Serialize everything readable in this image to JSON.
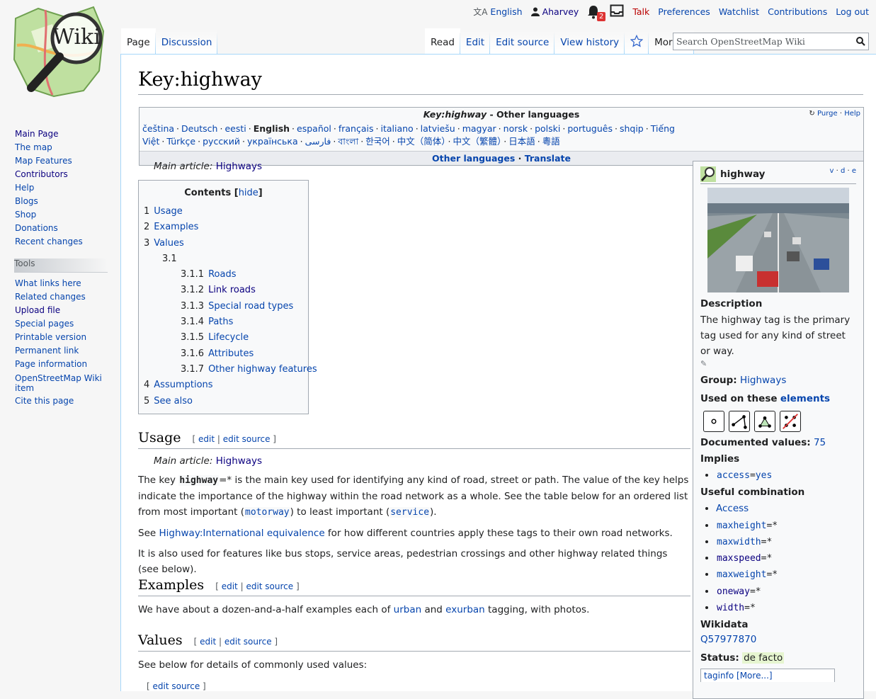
{
  "personal": {
    "language": "English",
    "user": "Aharvey",
    "notifications_count": "2",
    "talk": "Talk",
    "preferences": "Preferences",
    "watchlist": "Watchlist",
    "contributions": "Contributions",
    "logout": "Log out"
  },
  "tabs_left": [
    "Page",
    "Discussion"
  ],
  "tabs_right": [
    "Read",
    "Edit",
    "Edit source",
    "View history"
  ],
  "more_label": "More",
  "search": {
    "placeholder": "Search OpenStreetMap Wiki"
  },
  "sidebar": {
    "nav": [
      "Main Page",
      "The map",
      "Map Features",
      "Contributors",
      "Help",
      "Blogs",
      "Shop",
      "Donations",
      "Recent changes"
    ],
    "tools_heading": "Tools",
    "tools": [
      "What links here",
      "Related changes",
      "Upload file",
      "Special pages",
      "Printable version",
      "Permanent link",
      "Page information",
      "OpenStreetMap Wiki item",
      "Cite this page"
    ]
  },
  "page_title": "Key:highway",
  "langbox": {
    "title_italic": "Key:highway",
    "title_rest": " - Other languages",
    "purge": "Purge",
    "help": "Help",
    "languages": [
      "čeština",
      "Deutsch",
      "eesti",
      "English",
      "español",
      "français",
      "italiano",
      "latviešu",
      "magyar",
      "norsk",
      "polski",
      "português",
      "shqip",
      "Tiếng Việt",
      "Türkçe",
      "русский",
      "українська",
      "فارسی",
      "বাংলা",
      "한국어",
      "中文（简体）",
      "中文（繁體）",
      "日本語",
      "粵語"
    ],
    "footer_other": "Other languages",
    "footer_translate": "Translate"
  },
  "hatnote": {
    "prefix": "Main article:",
    "link": "Highways"
  },
  "toc": {
    "title": "Contents",
    "hide": "hide",
    "items": [
      {
        "num": "1",
        "text": "Usage",
        "level": 1
      },
      {
        "num": "2",
        "text": "Examples",
        "level": 1
      },
      {
        "num": "3",
        "text": "Values",
        "level": 1
      },
      {
        "num": "3.1",
        "text": "",
        "level": 2
      },
      {
        "num": "3.1.1",
        "text": "Roads",
        "level": 3
      },
      {
        "num": "3.1.2",
        "text": "Link roads",
        "level": 3
      },
      {
        "num": "3.1.3",
        "text": "Special road types",
        "level": 3
      },
      {
        "num": "3.1.4",
        "text": "Paths",
        "level": 3
      },
      {
        "num": "3.1.5",
        "text": "Lifecycle",
        "level": 3
      },
      {
        "num": "3.1.6",
        "text": "Attributes",
        "level": 3
      },
      {
        "num": "3.1.7",
        "text": "Other highway features",
        "level": 3
      },
      {
        "num": "4",
        "text": "Assumptions",
        "level": 1
      },
      {
        "num": "5",
        "text": "See also",
        "level": 1
      }
    ]
  },
  "edit_links": {
    "edit": "edit",
    "edit_source": "edit source"
  },
  "usage": {
    "heading": "Usage",
    "p1_a": "The key ",
    "p1_key": "highway",
    "p1_eq": "=*",
    "p1_b": " is the main key used for identifying any kind of road, street or path. The value of the key helps indicate the importance of the highway within the road network as a whole. See the table below for an ordered list from most important (",
    "p1_motorway": "motorway",
    "p1_c": ") to least important (",
    "p1_service": "service",
    "p1_d": ").",
    "p2_a": "See ",
    "p2_link": "Highway:International equivalence",
    "p2_b": " for how different countries apply these tags to their own road networks.",
    "p3": "It is also used for features like bus stops, service areas, pedestrian crossings and other highway related things (see below)."
  },
  "examples": {
    "heading": "Examples",
    "p_a": "We have about a dozen-and-a-half examples each of ",
    "urban": "urban",
    "and": " and ",
    "exurban": "exurban",
    "p_b": " tagging, with photos."
  },
  "values": {
    "heading": "Values",
    "p": "See below for details of commonly used values:",
    "sub_edit": "edit source"
  },
  "infobox": {
    "title": "highway",
    "vde": [
      "v",
      "d",
      "e"
    ],
    "description_label": "Description",
    "description": "The highway tag is the primary tag used for any kind of street or way.",
    "group_label": "Group:",
    "group": "Highways",
    "used_on_label": "Used on these",
    "used_on_link": "elements",
    "documented_label": "Documented values:",
    "documented_count": "75",
    "implies_label": "Implies",
    "implies": [
      {
        "key": "access",
        "value": "yes"
      }
    ],
    "useful_label": "Useful combination",
    "useful_access": "Access",
    "useful": [
      {
        "key": "maxheight",
        "value": "*",
        "visited": false
      },
      {
        "key": "maxwidth",
        "value": "*",
        "visited": false
      },
      {
        "key": "maxspeed",
        "value": "*",
        "visited": true
      },
      {
        "key": "maxweight",
        "value": "*",
        "visited": false
      },
      {
        "key": "oneway",
        "value": "*",
        "visited": true
      },
      {
        "key": "width",
        "value": "*",
        "visited": true
      }
    ],
    "wikidata_label": "Wikidata",
    "wikidata": "Q57977870",
    "status_label": "Status:",
    "status": "de facto",
    "taginfo": "taginfo",
    "more": "[More...]"
  }
}
